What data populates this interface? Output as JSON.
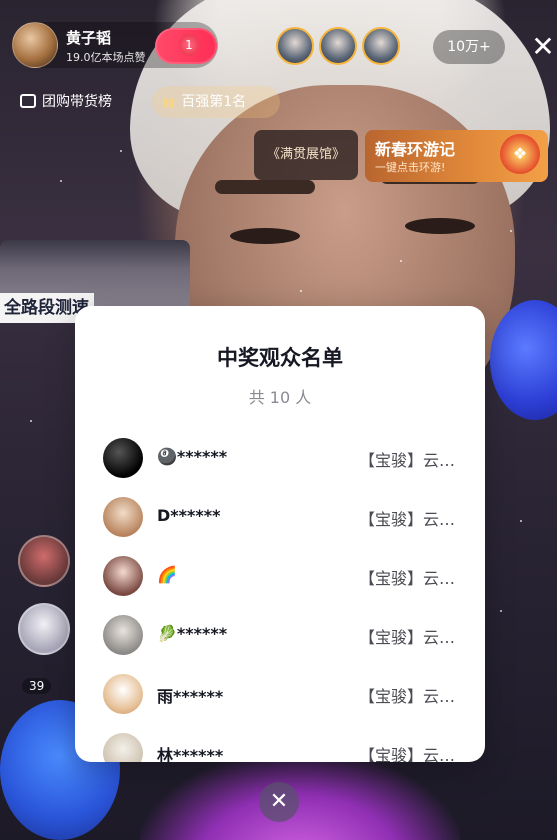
{
  "host": {
    "name": "黄子韬",
    "likes": "19.0亿本场点赞",
    "fav_count": "1"
  },
  "top": {
    "viewer_count": "10万+",
    "close_icon": "close-icon"
  },
  "pills": {
    "shop": "团购带货榜",
    "rank": "百强第1名"
  },
  "banners": {
    "gallery": "《满贯展馆》",
    "event_title": "新春环游记",
    "event_sub": "一键点击环游!"
  },
  "background": {
    "sign_text": "全路段测速",
    "side_count": "39"
  },
  "modal": {
    "title": "中奖观众名单",
    "subtitle": "共 10 人",
    "rows": [
      {
        "emoji": "🎱",
        "name": "🎱******",
        "prize": "【宝骏】云…"
      },
      {
        "emoji": "",
        "name": "D******",
        "prize": "【宝骏】云…"
      },
      {
        "emoji": "🌈",
        "name": "🌈",
        "prize": "【宝骏】云…"
      },
      {
        "emoji": "🥬",
        "name": "🥬******",
        "prize": "【宝骏】云…"
      },
      {
        "emoji": "",
        "name": "雨******",
        "prize": "【宝骏】云…"
      },
      {
        "emoji": "",
        "name": "林******",
        "prize": "【宝骏】云…"
      }
    ]
  },
  "colors": {
    "accent": "#ff2d55",
    "gold": "#f5b53c",
    "text": "#161823"
  }
}
